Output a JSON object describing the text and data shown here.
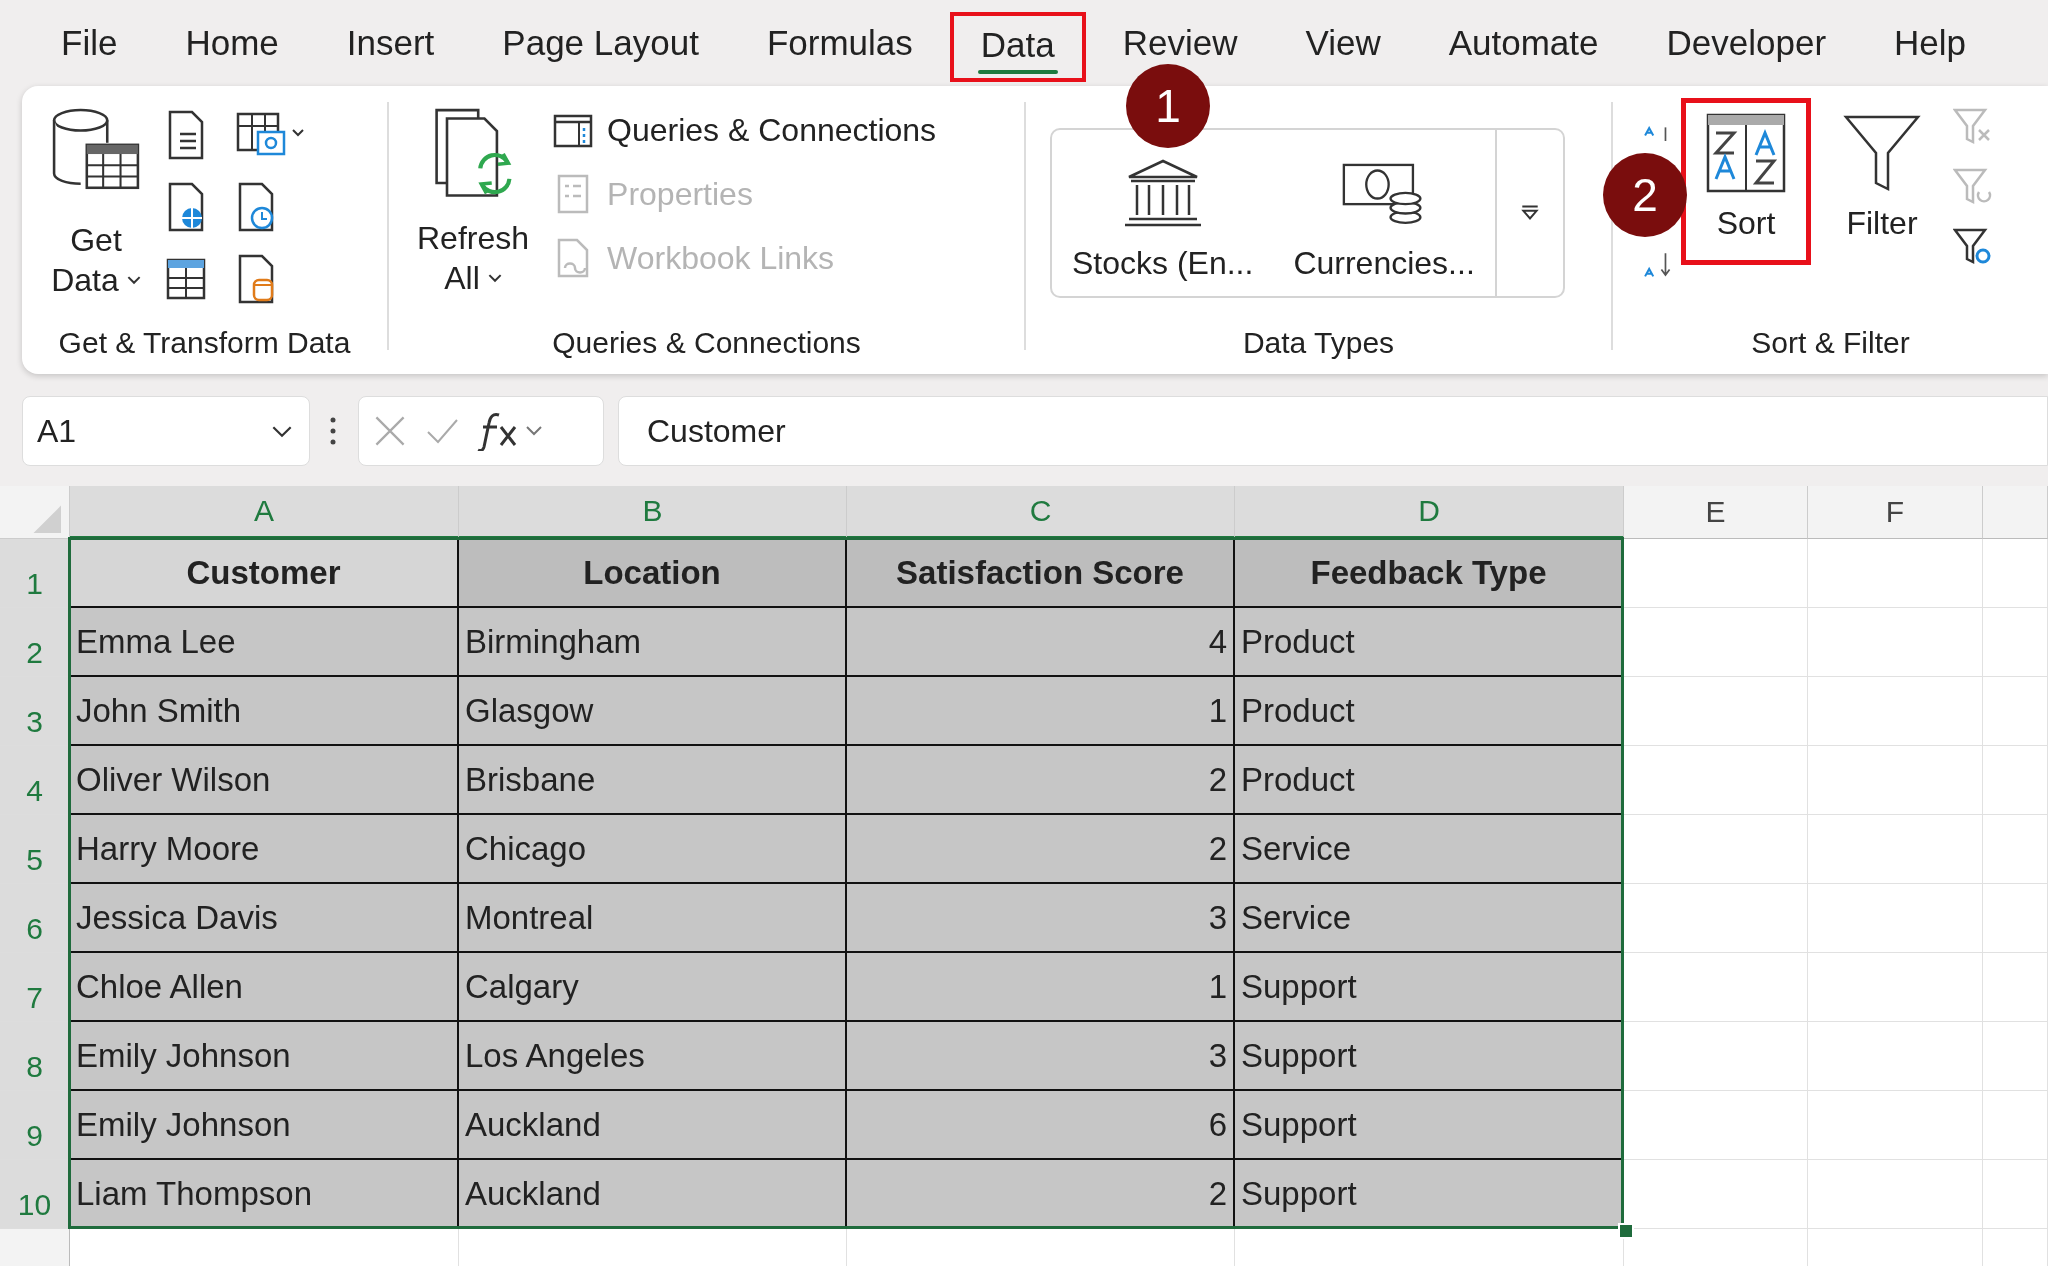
{
  "tabs": [
    {
      "label": "File",
      "selected": false,
      "highlighted": false
    },
    {
      "label": "Home",
      "selected": false,
      "highlighted": false
    },
    {
      "label": "Insert",
      "selected": false,
      "highlighted": false
    },
    {
      "label": "Page Layout",
      "selected": false,
      "highlighted": false
    },
    {
      "label": "Formulas",
      "selected": false,
      "highlighted": false
    },
    {
      "label": "Data",
      "selected": true,
      "highlighted": true
    },
    {
      "label": "Review",
      "selected": false,
      "highlighted": false
    },
    {
      "label": "View",
      "selected": false,
      "highlighted": false
    },
    {
      "label": "Automate",
      "selected": false,
      "highlighted": false
    },
    {
      "label": "Developer",
      "selected": false,
      "highlighted": false
    },
    {
      "label": "Help",
      "selected": false,
      "highlighted": false
    }
  ],
  "callouts": [
    {
      "label": "1"
    },
    {
      "label": "2"
    }
  ],
  "ribbon": {
    "groups": [
      {
        "kind": "get_transform",
        "label": "Get & Transform Data",
        "button": {
          "lines": [
            "Get",
            "Data"
          ]
        }
      },
      {
        "kind": "queries",
        "label": "Queries & Connections",
        "button": {
          "lines": [
            "Refresh",
            "All"
          ]
        },
        "items": [
          {
            "label": "Queries & Connections",
            "disabled": false
          },
          {
            "label": "Properties",
            "disabled": true
          },
          {
            "label": "Workbook Links",
            "disabled": true
          }
        ]
      },
      {
        "kind": "data_types",
        "label": "Data Types",
        "items": [
          {
            "label": "Stocks (En..."
          },
          {
            "label": "Currencies..."
          }
        ]
      },
      {
        "kind": "sort_filter",
        "label": "Sort & Filter",
        "buttons": [
          {
            "kind": "sort",
            "label": "Sort",
            "highlighted": true
          },
          {
            "kind": "filter",
            "label": "Filter",
            "highlighted": false
          }
        ]
      }
    ]
  },
  "formula_bar": {
    "name_box": "A1",
    "formula": "Customer"
  },
  "sheet": {
    "columns": [
      {
        "label": "A",
        "selected": true
      },
      {
        "label": "B",
        "selected": true
      },
      {
        "label": "C",
        "selected": true
      },
      {
        "label": "D",
        "selected": true
      },
      {
        "label": "E",
        "selected": false
      },
      {
        "label": "F",
        "selected": false
      }
    ],
    "row_headers": [
      {
        "label": "1",
        "selected": true
      },
      {
        "label": "2",
        "selected": true
      },
      {
        "label": "3",
        "selected": true
      },
      {
        "label": "4",
        "selected": true
      },
      {
        "label": "5",
        "selected": true
      },
      {
        "label": "6",
        "selected": true
      },
      {
        "label": "7",
        "selected": true
      },
      {
        "label": "8",
        "selected": true
      },
      {
        "label": "9",
        "selected": true
      },
      {
        "label": "10",
        "selected": true
      }
    ],
    "header": [
      {
        "text": "Customer",
        "kind": "text",
        "active": true
      },
      {
        "text": "Location",
        "kind": "text",
        "active": false
      },
      {
        "text": "Satisfaction Score",
        "kind": "number",
        "active": false
      },
      {
        "text": "Feedback Type",
        "kind": "text",
        "active": false
      }
    ],
    "rows": [
      [
        "Emma Lee",
        "Birmingham",
        "4",
        "Product"
      ],
      [
        "John Smith",
        "Glasgow",
        "1",
        "Product"
      ],
      [
        "Oliver Wilson",
        "Brisbane",
        "2",
        "Product"
      ],
      [
        "Harry Moore",
        "Chicago",
        "2",
        "Service"
      ],
      [
        "Jessica Davis",
        "Montreal",
        "3",
        "Service"
      ],
      [
        "Chloe Allen",
        "Calgary",
        "1",
        "Support"
      ],
      [
        "Emily Johnson",
        "Los Angeles",
        "3",
        "Support"
      ],
      [
        "Emily Johnson",
        "Auckland",
        "6",
        "Support"
      ],
      [
        "Liam Thompson",
        "Auckland",
        "2",
        "Support"
      ]
    ]
  }
}
